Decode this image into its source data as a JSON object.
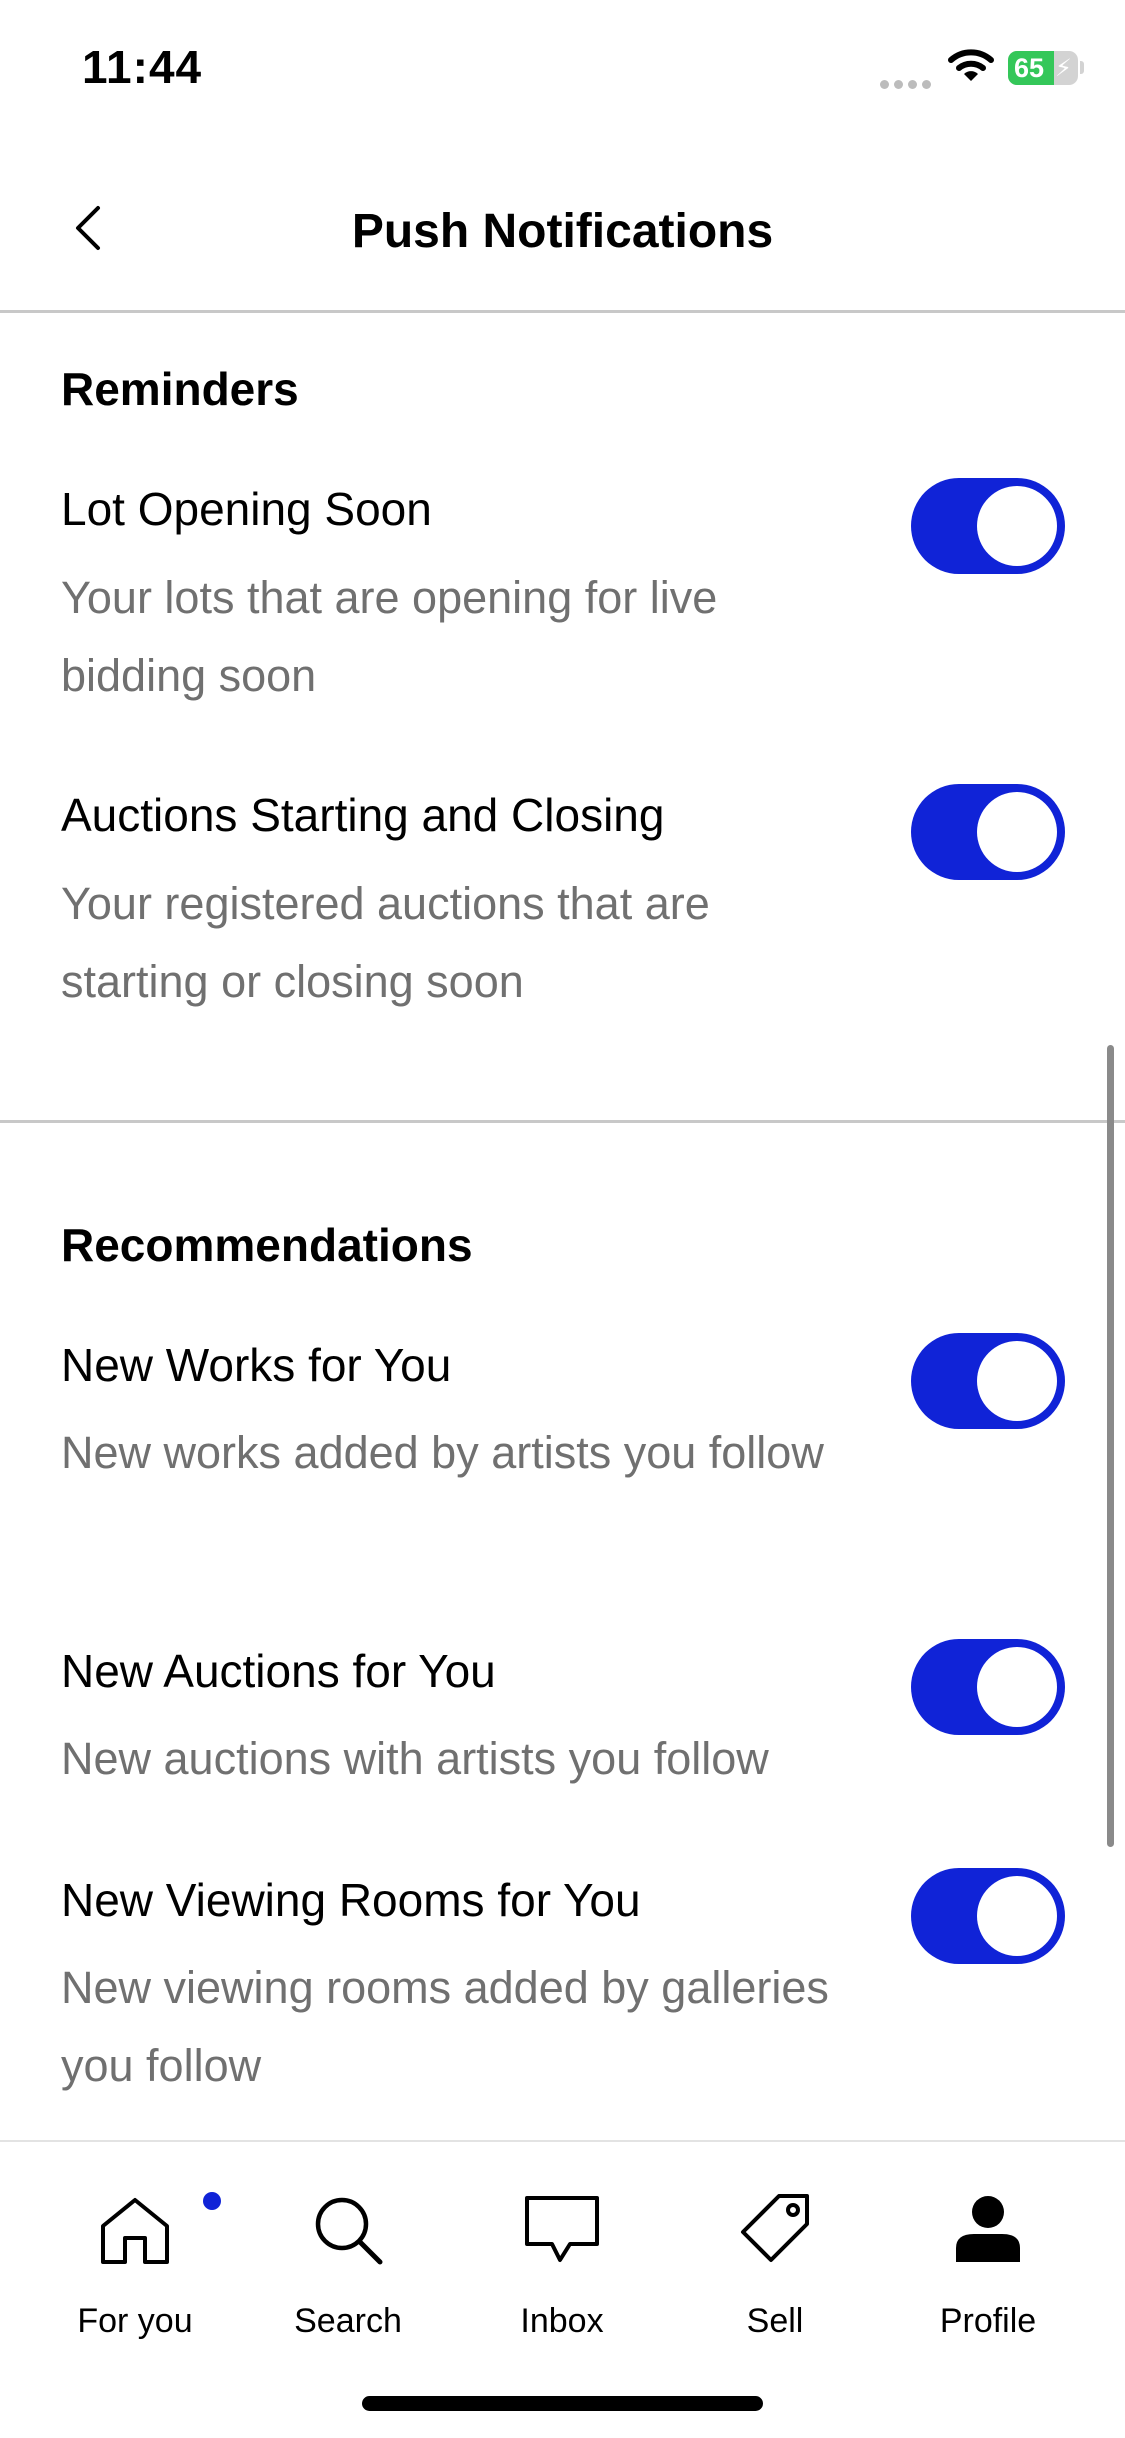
{
  "status_bar": {
    "time": "11:44",
    "battery_level": "65",
    "battery_fraction": 0.65
  },
  "header": {
    "title": "Push Notifications"
  },
  "sections": [
    {
      "title": "Reminders",
      "items": [
        {
          "title": "Lot Opening Soon",
          "description": "Your lots that are opening for live bidding soon",
          "enabled": true
        },
        {
          "title": "Auctions Starting and Closing",
          "description": "Your registered auctions that are starting or closing soon",
          "enabled": true
        }
      ]
    },
    {
      "title": "Recommendations",
      "items": [
        {
          "title": "New Works for You",
          "description": "New works added by artists you follow",
          "enabled": true
        },
        {
          "title": "New Auctions for You",
          "description": "New auctions with artists you follow",
          "enabled": true
        },
        {
          "title": "New Viewing Rooms for You",
          "description": "New viewing rooms added by galleries you follow",
          "enabled": true
        }
      ]
    }
  ],
  "tab_bar": {
    "items": [
      {
        "label": "For you",
        "icon": "home-icon",
        "has_notification": true
      },
      {
        "label": "Search",
        "icon": "search-icon"
      },
      {
        "label": "Inbox",
        "icon": "inbox-icon"
      },
      {
        "label": "Sell",
        "icon": "tag-icon"
      },
      {
        "label": "Profile",
        "icon": "profile-icon",
        "active": true
      }
    ]
  },
  "colors": {
    "accent": "#1023d7",
    "secondary_text": "#707070",
    "divider": "#c8c8c8",
    "battery": "#34c759"
  }
}
